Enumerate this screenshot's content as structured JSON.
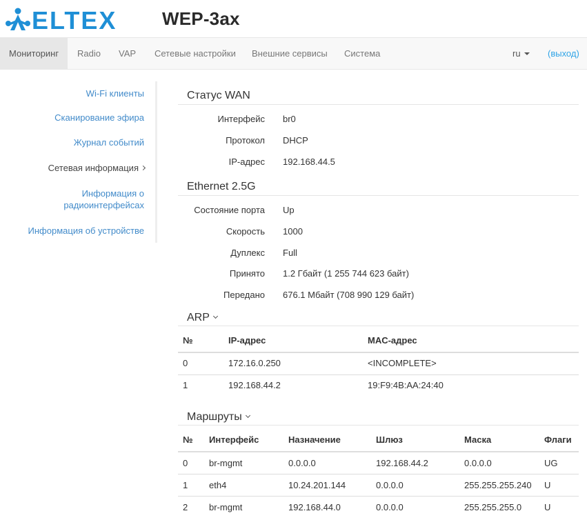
{
  "header": {
    "logo_text": "ELTEX",
    "product_title": "WEP-3ax"
  },
  "navbar": {
    "items": [
      {
        "label": "Мониторинг",
        "active": true
      },
      {
        "label": "Radio"
      },
      {
        "label": "VAP"
      },
      {
        "label": "Сетевые настройки"
      },
      {
        "label": "Внешние сервисы"
      },
      {
        "label": "Система"
      }
    ],
    "language": "ru",
    "logout": "(выход)"
  },
  "sidebar": {
    "items": [
      {
        "label": "Wi-Fi клиенты"
      },
      {
        "label": "Сканирование эфира"
      },
      {
        "label": "Журнал событий"
      },
      {
        "label": "Сетевая информация",
        "current": true
      },
      {
        "label": "Информация о",
        "label2": "радиоинтерфейсах"
      },
      {
        "label": "Информация об устройстве"
      }
    ]
  },
  "wan": {
    "title": "Статус WAN",
    "rows": [
      {
        "label": "Интерфейс",
        "value": "br0"
      },
      {
        "label": "Протокол",
        "value": "DHCP"
      },
      {
        "label": "IP-адрес",
        "value": "192.168.44.5"
      }
    ]
  },
  "ethernet": {
    "title": "Ethernet 2.5G",
    "rows": [
      {
        "label": "Состояние порта",
        "value": "Up"
      },
      {
        "label": "Скорость",
        "value": "1000"
      },
      {
        "label": "Дуплекс",
        "value": "Full"
      },
      {
        "label": "Принято",
        "value": "1.2 Гбайт (1 255 744 623 байт)"
      },
      {
        "label": "Передано",
        "value": "676.1 Мбайт (708 990 129 байт)"
      }
    ]
  },
  "arp": {
    "title": "ARP",
    "columns": [
      "№",
      "IP-адрес",
      "MAC-адрес"
    ],
    "rows": [
      [
        "0",
        "172.16.0.250",
        "<INCOMPLETE>"
      ],
      [
        "1",
        "192.168.44.2",
        "19:F9:4B:AA:24:40"
      ]
    ]
  },
  "routes": {
    "title": "Маршруты",
    "columns": [
      "№",
      "Интерфейс",
      "Назначение",
      "Шлюз",
      "Маска",
      "Флаги"
    ],
    "rows": [
      [
        "0",
        "br-mgmt",
        "0.0.0.0",
        "192.168.44.2",
        "0.0.0.0",
        "UG"
      ],
      [
        "1",
        "eth4",
        "10.24.201.144",
        "0.0.0.0",
        "255.255.255.240",
        "U"
      ],
      [
        "2",
        "br-mgmt",
        "192.168.44.0",
        "0.0.0.0",
        "255.255.255.0",
        "U"
      ]
    ]
  },
  "colors": {
    "accent": "#2fa4e7",
    "link": "#428bca",
    "logo_blue": "#1f8fd6"
  }
}
